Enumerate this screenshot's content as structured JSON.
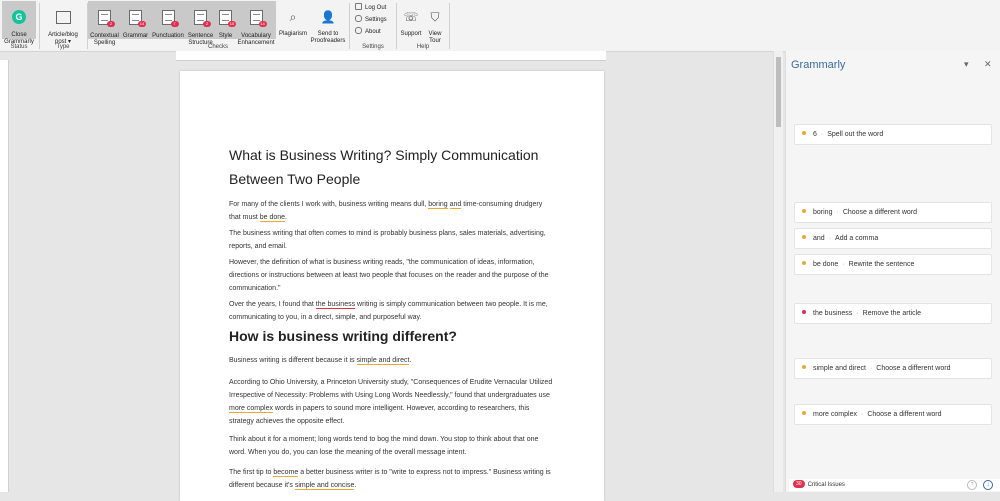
{
  "ribbon": {
    "status": {
      "label": "Status",
      "close": "Close\nGrammarly"
    },
    "type": {
      "label": "Type",
      "article": "Article/blog\npost ▾"
    },
    "checks": {
      "label": "Checks",
      "items": [
        {
          "label": "Contextual\nSpelling",
          "count": "2"
        },
        {
          "label": "Grammar",
          "count": "14"
        },
        {
          "label": "Punctuation",
          "count": "7"
        },
        {
          "label": "Sentence\nStructure",
          "count": "2"
        },
        {
          "label": "Style",
          "count": "10"
        },
        {
          "label": "Vocabulary\nEnhancement",
          "count": "14"
        }
      ]
    },
    "plagiarism": "Plagiarism",
    "proofreaders": "Send to\nProofreaders",
    "settings": {
      "label": "Settings",
      "logout": "Log Out",
      "settings": "Settings",
      "about": "About"
    },
    "help": {
      "label": "Help",
      "support": "Support",
      "tour": "View\nTour"
    }
  },
  "document": {
    "title": "What is Business Writing? Simply Communication Between Two People",
    "p1a": "For many of the clients I work with, business writing means dull, ",
    "p1b": "boring",
    "p1c": " ",
    "p1d": "and",
    "p1e": " time-consuming drudgery that must ",
    "p1f": "be done",
    "p1g": ".",
    "p2": "The business writing that often comes to mind is probably business plans, sales materials, advertising, reports, and email.",
    "p3": "However, the definition of what is business writing reads, \"the communication of ideas, information, directions or instructions between at least two people that focuses on the reader and the purpose of the communication.\"",
    "p4a": "Over the years, I found that ",
    "p4b": "the business",
    "p4c": " writing is simply communication between two people. It is me, communicating to you, in a direct, simple, and purposeful way.",
    "h2": "How is business writing different?",
    "p5a": "Business writing is different because it is ",
    "p5b": "simple and direct",
    "p5c": ".",
    "p6a": "According to Ohio University, a Princeton University study, \"Consequences of Erudite Vernacular Utilized Irrespective of Necessity:  Problems with Using Long Words Needlessly,\" found that undergraduates use ",
    "p6b": "more complex",
    "p6c": " words in papers to sound more intelligent.  However, according to researchers, this strategy achieves the opposite effect.",
    "p7": "Think about it for a moment; long words tend to bog the mind down. You stop to think about that one word. When you do, you can lose the meaning of the overall message intent.",
    "p8a": "The first tip to ",
    "p8b": "become",
    "p8c": " a better business writer is to \"write to express not to impress.\" Business writing is different because it's ",
    "p8d": "simple and concise",
    "p8e": "."
  },
  "panel": {
    "title": "Grammarly",
    "cards": [
      {
        "term": "6",
        "suggestion": "Spell out the word",
        "color": "#e8a93b"
      },
      {
        "term": "boring",
        "suggestion": "Choose a different word",
        "color": "#e8a93b"
      },
      {
        "term": "and",
        "suggestion": "Add a comma",
        "color": "#e8a93b"
      },
      {
        "term": "be done",
        "suggestion": "Rewrite the sentence",
        "color": "#e8a93b"
      },
      {
        "term": "the business",
        "suggestion": "Remove the article",
        "color": "#d6334a"
      },
      {
        "term": "simple and direct",
        "suggestion": "Choose a different word",
        "color": "#e8a93b"
      },
      {
        "term": "more complex",
        "suggestion": "Choose a different word",
        "color": "#e8a93b"
      }
    ],
    "critical_count": "30",
    "critical_label": "Critical Issues"
  },
  "colors": {
    "accent": "#3b6aa0",
    "critical": "#e0324f",
    "warning": "#e8a93b"
  }
}
